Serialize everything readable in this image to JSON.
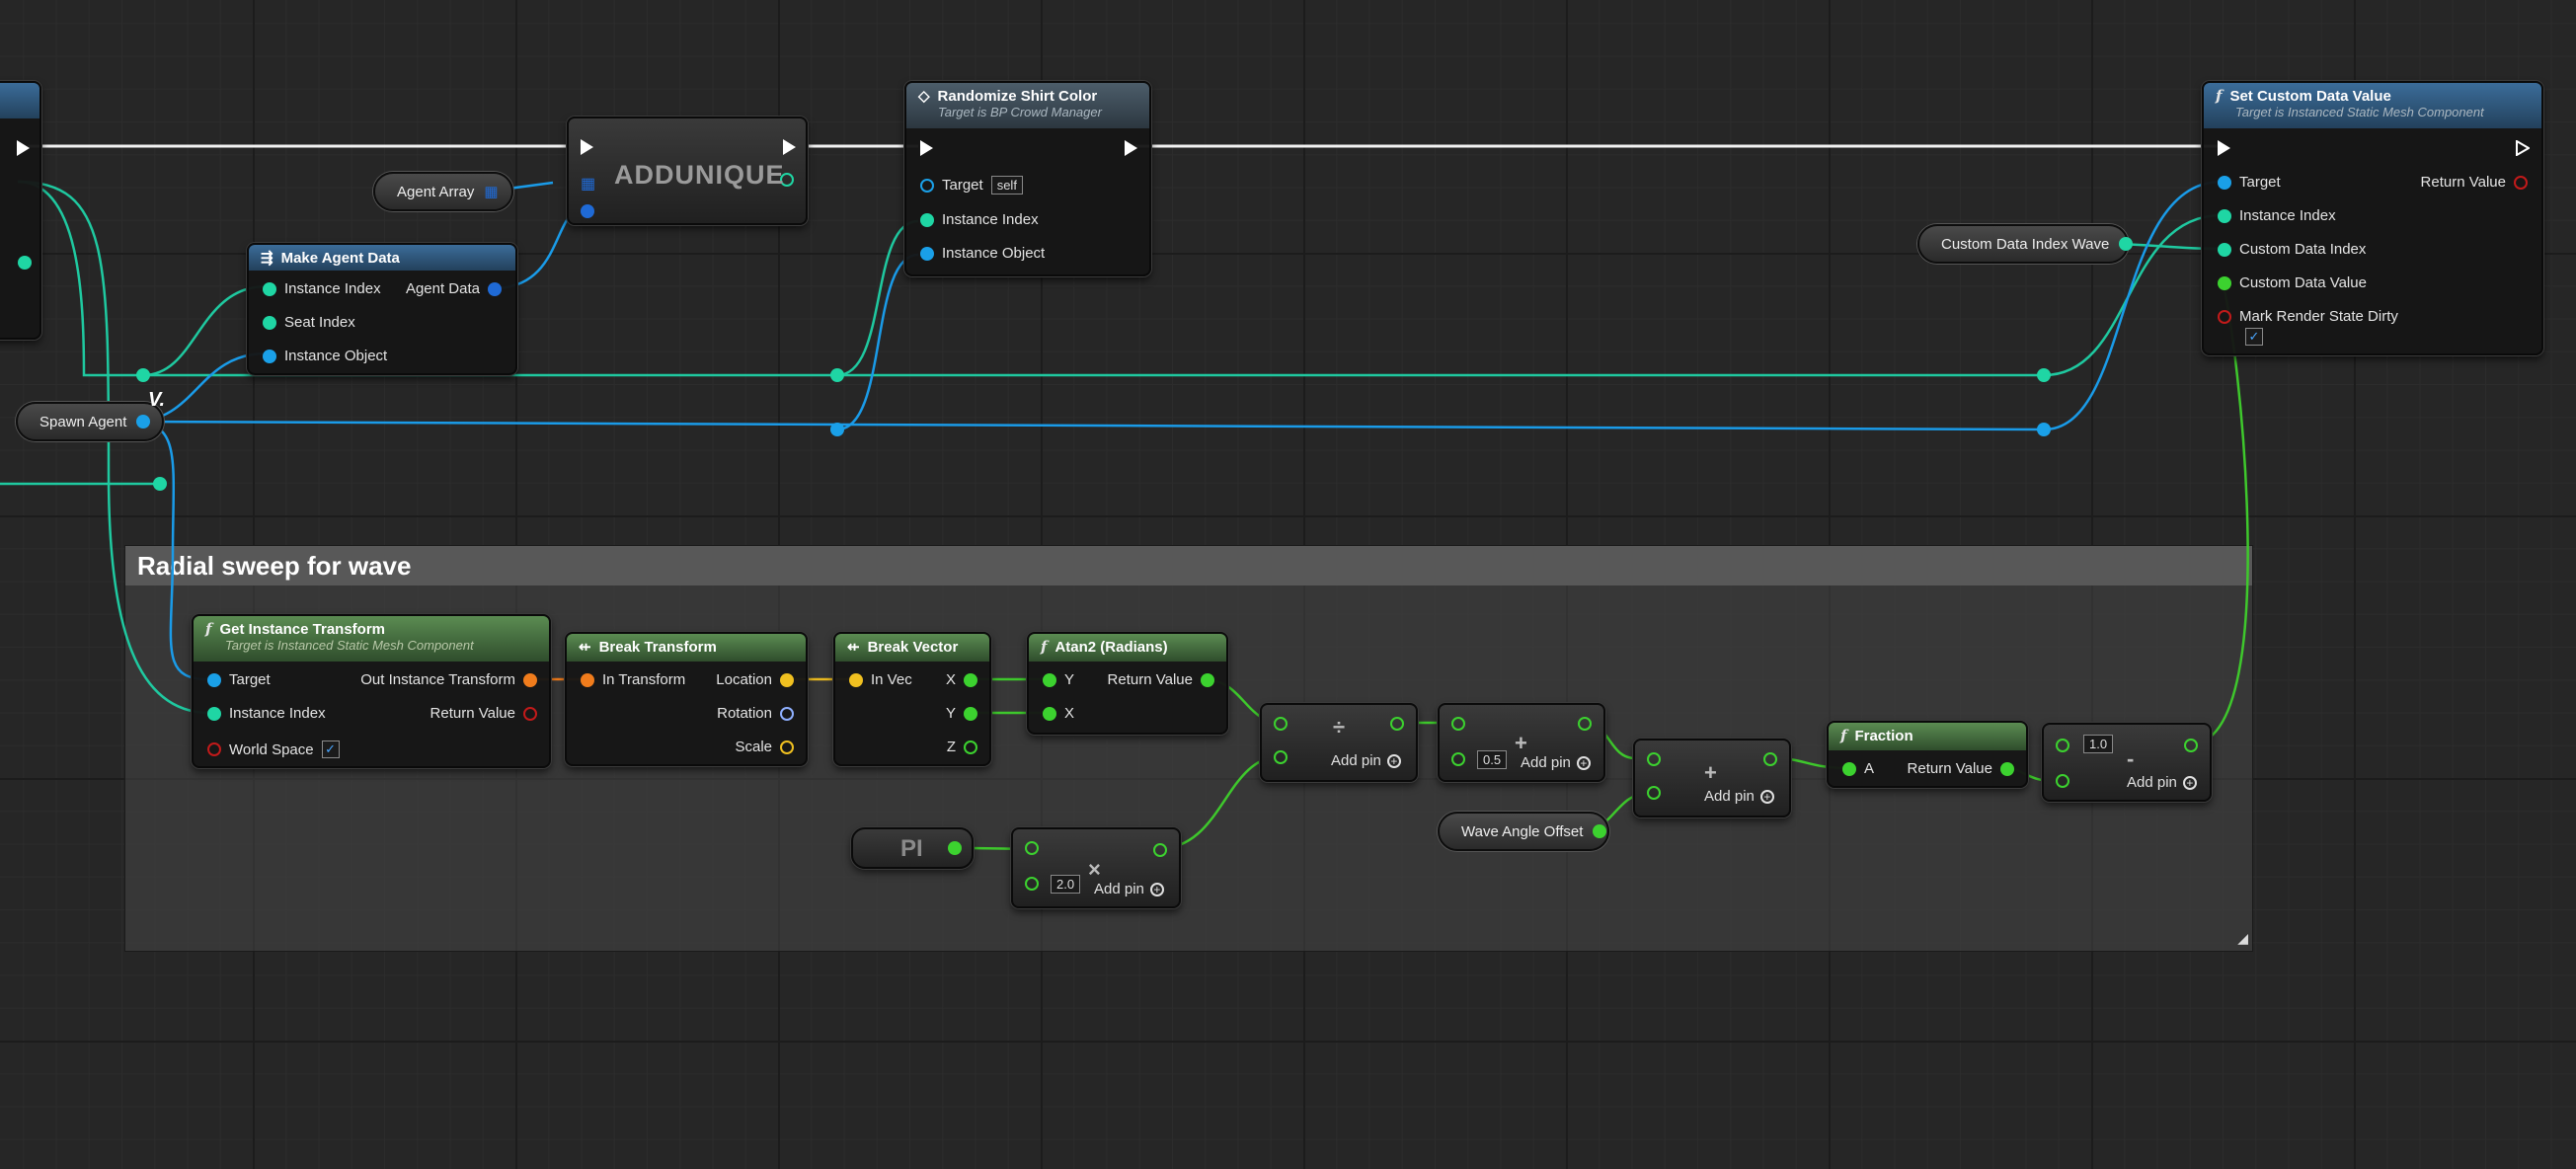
{
  "comment": {
    "title": "Radial sweep for wave"
  },
  "nodes": {
    "add_unique": {
      "label": "ADDUNIQUE"
    },
    "randomize": {
      "title": "Randomize Shirt Color",
      "subtitle": "Target is BP Crowd Manager",
      "target": "Target",
      "target_default": "self",
      "instance_index": "Instance Index",
      "instance_object": "Instance Object"
    },
    "set_custom": {
      "title": "Set Custom Data Value",
      "subtitle": "Target is Instanced Static Mesh Component",
      "target": "Target",
      "instance_index": "Instance Index",
      "custom_data_index": "Custom Data Index",
      "custom_data_value": "Custom Data Value",
      "mark_render": "Mark Render State Dirty",
      "return_value": "Return Value",
      "mark_render_checked": true
    },
    "make_agent": {
      "title": "Make Agent Data",
      "instance_index": "Instance Index",
      "seat_index": "Seat Index",
      "instance_object": "Instance Object",
      "agent_data": "Agent Data"
    },
    "get_transform": {
      "title": "Get Instance Transform",
      "subtitle": "Target is Instanced Static Mesh Component",
      "target": "Target",
      "instance_index": "Instance Index",
      "world_space": "World Space",
      "out_transform": "Out Instance Transform",
      "return_value": "Return Value",
      "world_space_checked": true
    },
    "break_transform": {
      "title": "Break Transform",
      "in_transform": "In Transform",
      "location": "Location",
      "rotation": "Rotation",
      "scale": "Scale"
    },
    "break_vector": {
      "title": "Break Vector",
      "in_vec": "In Vec",
      "x": "X",
      "y": "Y",
      "z": "Z"
    },
    "atan2": {
      "title": "Atan2 (Radians)",
      "y": "Y",
      "x": "X",
      "return_value": "Return Value"
    },
    "divide": {
      "symbol": "÷",
      "add_pin": "Add pin"
    },
    "add1": {
      "symbol": "+",
      "add_pin": "Add pin",
      "value": "0.5"
    },
    "add2": {
      "symbol": "+",
      "add_pin": "Add pin"
    },
    "multiply": {
      "symbol": "×",
      "add_pin": "Add pin",
      "value": "2.0"
    },
    "fraction": {
      "title": "Fraction",
      "a": "A",
      "return_value": "Return Value"
    },
    "subtract": {
      "symbol": "-",
      "add_pin": "Add pin",
      "value": "1.0"
    },
    "pi": {
      "label": "PI"
    }
  },
  "variables": {
    "agent_array": "Agent Array",
    "spawn_agent": "Spawn Agent",
    "custom_data_index_wave": "Custom Data Index Wave",
    "wave_angle_offset": "Wave Angle Offset"
  },
  "colors": {
    "exec": "#ffffff",
    "integer": "#1fd6a4",
    "object": "#1aa0e8",
    "float": "#3cd22f",
    "transform": "#f07c1c",
    "vector": "#f0c020",
    "rotator": "#8fb0ff",
    "boolean": "#c21a1a",
    "struct": "#1f6ad6"
  }
}
